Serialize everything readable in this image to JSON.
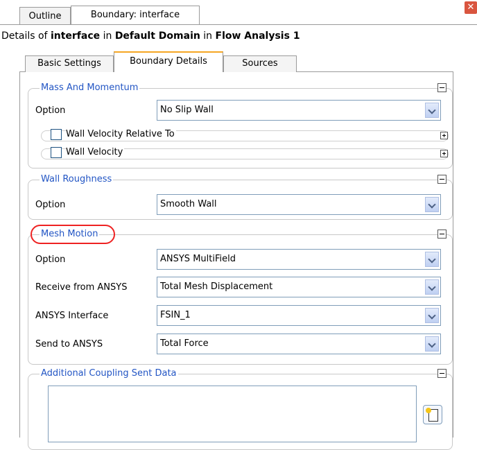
{
  "top_tabs": {
    "outline": "Outline",
    "boundary": "Boundary: interface"
  },
  "details": {
    "prefix": "Details of ",
    "object": "interface",
    "mid1": " in ",
    "domain": "Default Domain",
    "mid2": " in ",
    "analysis": "Flow Analysis 1"
  },
  "sub_tabs": {
    "basic": "Basic Settings",
    "boundary": "Boundary Details",
    "sources": "Sources"
  },
  "mass_momentum": {
    "title": "Mass And Momentum",
    "option_label": "Option",
    "option_value": "No Slip Wall",
    "wall_velocity_relative": "Wall Velocity Relative To",
    "wall_velocity": "Wall Velocity"
  },
  "wall_roughness": {
    "title": "Wall Roughness",
    "option_label": "Option",
    "option_value": "Smooth Wall"
  },
  "mesh_motion": {
    "title": "Mesh Motion",
    "option_label": "Option",
    "option_value": "ANSYS MultiField",
    "receive_label": "Receive from ANSYS",
    "receive_value": "Total Mesh Displacement",
    "interface_label": "ANSYS Interface",
    "interface_value": "FSIN_1",
    "send_label": "Send to ANSYS",
    "send_value": "Total Force"
  },
  "coupling": {
    "title": "Additional Coupling Sent Data"
  },
  "colors": {
    "legend": "#2255c4",
    "active_tab_accent": "#f5a623",
    "annotation": "#e22222"
  }
}
